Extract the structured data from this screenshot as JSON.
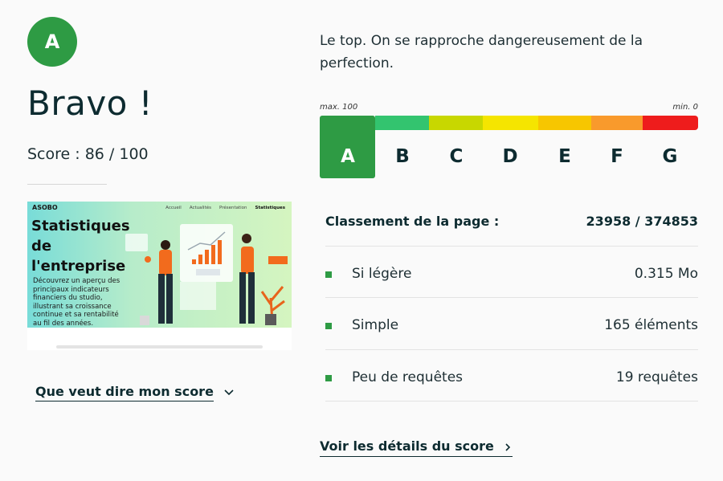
{
  "grade": {
    "letter": "A"
  },
  "title": "Bravo !",
  "score_text": "Score : 86 / 100",
  "thumbnail": {
    "logo": "ASOBO",
    "nav": [
      "Accueil",
      "Actualités",
      "Présentation",
      "Statistiques"
    ],
    "heading": "Statistiques de l'entreprise",
    "description": "Découvrez un aperçu des principaux indicateurs financiers du studio, illustrant sa croissance continue et sa rentabilité au fil des années.",
    "colors": {
      "accent": "#f26b1d",
      "gradient_start": "#78dcd8",
      "gradient_end": "#d5f5c0"
    }
  },
  "description": "Le top. On se rapproche dangereusement de la perfection.",
  "scale": {
    "max_label": "max. 100",
    "min_label": "min. 0",
    "active": "A",
    "grades": [
      {
        "letter": "A",
        "color": "#2e9b44"
      },
      {
        "letter": "B",
        "color": "#33c46f"
      },
      {
        "letter": "C",
        "color": "#c8d700"
      },
      {
        "letter": "D",
        "color": "#f5e500"
      },
      {
        "letter": "E",
        "color": "#f7c600"
      },
      {
        "letter": "F",
        "color": "#f99a2c"
      },
      {
        "letter": "G",
        "color": "#ee1c1c"
      }
    ]
  },
  "ranking": {
    "label": "Classement de la page :",
    "value": "23958 / 374853"
  },
  "metrics": [
    {
      "label": "Si légère",
      "value": "0.315 Mo"
    },
    {
      "label": "Simple",
      "value": "165 éléments"
    },
    {
      "label": "Peu de requêtes",
      "value": "19 requêtes"
    }
  ],
  "links": {
    "score_meaning": "Que veut dire mon score",
    "score_details": "Voir les détails du score"
  },
  "colors": {
    "brand_green": "#2e9b44",
    "text_dark": "#0d2b30"
  },
  "icons": {
    "chevron_down": "chevron-down-icon",
    "chevron_right": "chevron-right-icon"
  }
}
